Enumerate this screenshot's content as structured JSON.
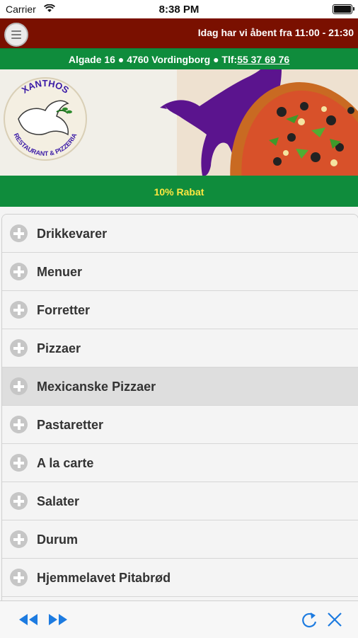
{
  "status_bar": {
    "carrier": "Carrier",
    "time": "8:38 PM"
  },
  "header": {
    "hours_text": "Idag har vi åbent fra 11:00 - 21:30"
  },
  "address": {
    "text": "Algade 16 ● 4760 Vordingborg ● Tlf:",
    "phone": "55 37 69 76"
  },
  "banner": {
    "logo_top": "XANTHOS",
    "logo_bottom": "RESTAURANT & PIZZERIA"
  },
  "discount": {
    "text": "10% Rabat"
  },
  "menu": {
    "items": [
      {
        "label": "Drikkevarer"
      },
      {
        "label": "Menuer"
      },
      {
        "label": "Forretter"
      },
      {
        "label": "Pizzaer"
      },
      {
        "label": "Mexicanske Pizzaer"
      },
      {
        "label": "Pastaretter"
      },
      {
        "label": "A la carte"
      },
      {
        "label": "Salater"
      },
      {
        "label": "Durum"
      },
      {
        "label": "Hjemmelavet Pitabrød"
      }
    ],
    "active_index": 4
  },
  "colors": {
    "header": "#7a1000",
    "green": "#0f8c3c",
    "discount_text": "#ffe840",
    "toolbar_icons": "#1d7be0"
  }
}
